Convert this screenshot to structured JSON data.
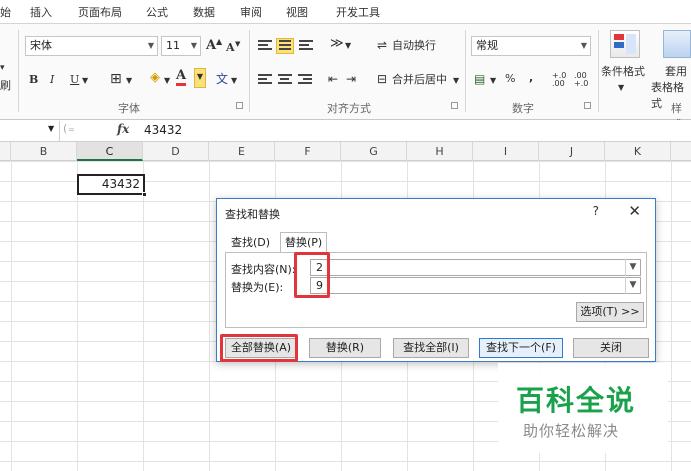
{
  "ribbon_tabs": [
    "始",
    "插入",
    "页面布局",
    "公式",
    "数据",
    "审阅",
    "视图",
    "开发工具"
  ],
  "ribbon": {
    "clipboard_partial": "刷",
    "font_name": "宋体",
    "font_size": "11",
    "grow_font": "A",
    "shrink_font": "A",
    "bold": "B",
    "italic": "I",
    "underline": "U",
    "font_color_letter": "A",
    "phonetic": "文",
    "font_group": "字体",
    "wrap_text": "自动换行",
    "merge_center": "合并后居中",
    "alignment_group": "对齐方式",
    "number_format": "常规",
    "percent": "%",
    "comma": ",",
    "inc_decimal": "+.0 .00",
    "dec_decimal": ".00 +.0",
    "number_group": "数字",
    "cond_format": "条件格式",
    "table_format_top": "套用",
    "table_format_bottom": "表格格式",
    "styles_group": "样式"
  },
  "formula_bar": {
    "fx": "fx",
    "value": "43432"
  },
  "columns": [
    {
      "label": "B",
      "selected": false
    },
    {
      "label": "C",
      "selected": true
    },
    {
      "label": "D",
      "selected": false
    },
    {
      "label": "E",
      "selected": false
    },
    {
      "label": "F",
      "selected": false
    },
    {
      "label": "G",
      "selected": false
    },
    {
      "label": "H",
      "selected": false
    },
    {
      "label": "I",
      "selected": false
    },
    {
      "label": "J",
      "selected": false
    },
    {
      "label": "K",
      "selected": false
    }
  ],
  "active_cell": {
    "value": "43432"
  },
  "dialog": {
    "title": "查找和替换",
    "help": "?",
    "close": "✕",
    "tab_find": "查找(D)",
    "tab_replace": "替换(P)",
    "find_label": "查找内容(N):",
    "find_value": "2",
    "replace_label": "替换为(E):",
    "replace_value": "9",
    "options_button": "选项(T) >>",
    "replace_all": "全部替换(A)",
    "replace": "替换(R)",
    "find_all": "查找全部(I)",
    "find_next": "查找下一个(F)",
    "close_button": "关闭"
  },
  "watermark": {
    "main": "百科全说",
    "sub": "助你轻松解决"
  },
  "colors": {
    "highlight": "#e0353a",
    "watermark_green": "#1aa14b",
    "dialog_border": "#3d7bc7"
  }
}
